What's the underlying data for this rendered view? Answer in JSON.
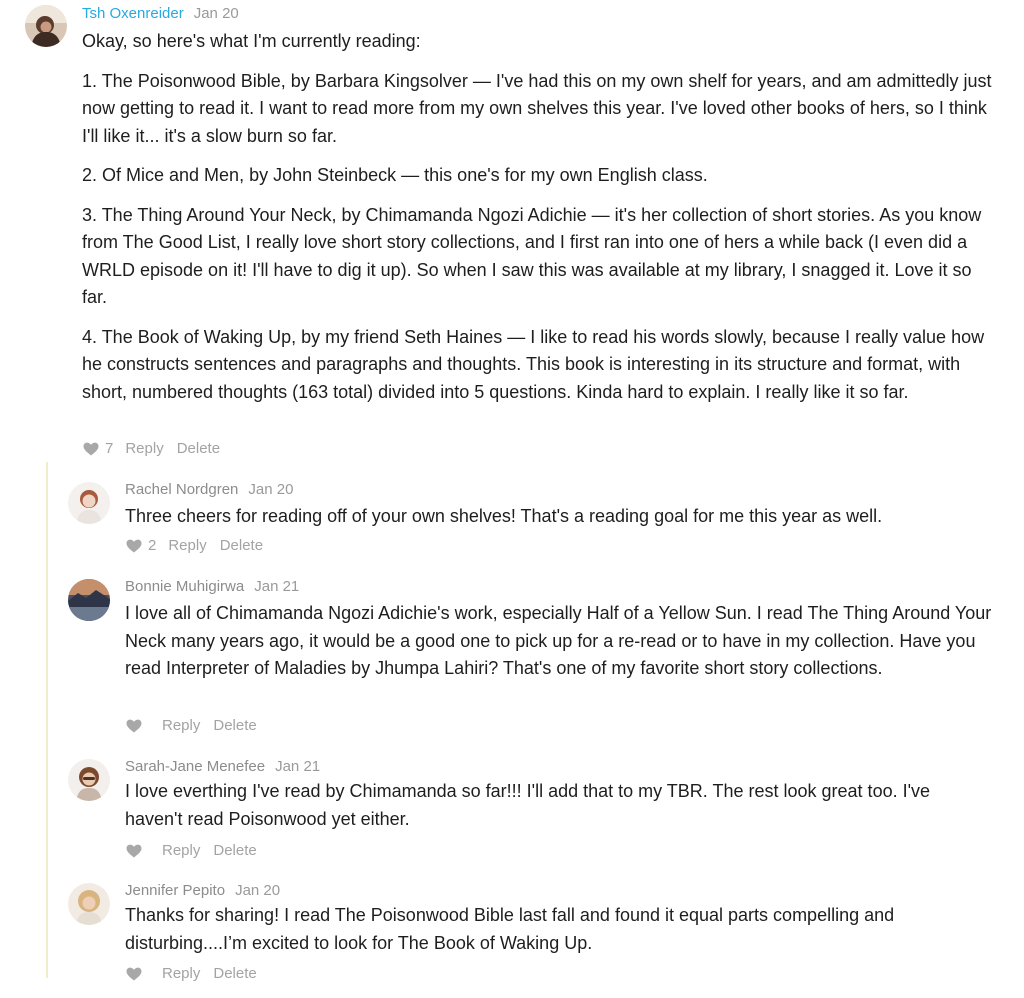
{
  "comments": [
    {
      "author": "Tsh Oxenreider",
      "date": "Jan 20",
      "paragraphs": [
        "Okay, so here's what I'm currently reading:",
        "1. The Poisonwood Bible, by Barbara Kingsolver — I've had this on my own shelf for years, and am admittedly just now getting to read it. I want to read more from my own shelves this year. I've loved other books of hers, so I think I'll like it... it's a slow burn so far.",
        "2. Of Mice and Men, by John Steinbeck — this one's for my own English class.",
        "3. The Thing Around Your Neck, by Chimamanda Ngozi Adichie — it's her collection of short stories. As you know from The Good List, I really love short story collections, and I first ran into one of hers a while back (I even did a WRLD episode on it! I'll have to dig it up). So when I saw this was available at my library, I snagged it. Love it so far.",
        "4. The Book of Waking Up, by my friend Seth Haines — I like to read his words slowly, because I really value how he constructs sentences and paragraphs and thoughts. This book is interesting in its structure and format, with short, numbered thoughts (163 total) divided into 5 questions. Kinda hard to explain. I really like it so far."
      ],
      "likes": "7",
      "reply_label": "Reply",
      "delete_label": "Delete"
    },
    {
      "author": "Rachel Nordgren",
      "date": "Jan 20",
      "paragraphs": [
        "Three cheers for reading off of your own shelves! That's a reading goal for me this year as well."
      ],
      "likes": "2",
      "reply_label": "Reply",
      "delete_label": "Delete"
    },
    {
      "author": "Bonnie Muhigirwa",
      "date": "Jan 21",
      "paragraphs": [
        "I love all of Chimamanda Ngozi Adichie's work, especially Half of a Yellow Sun. I read The Thing Around Your Neck many years ago, it would be a good one to pick up for a re-read or to have in my collection. Have you read Interpreter of Maladies by Jhumpa Lahiri? That's one of my favorite short story collections."
      ],
      "likes": "",
      "reply_label": "Reply",
      "delete_label": "Delete"
    },
    {
      "author": "Sarah-Jane Menefee",
      "date": "Jan 21",
      "paragraphs": [
        "I love everthing I've read by Chimamanda so far!!! I'll add that to my TBR. The rest look great too. I've haven't read Poisonwood yet either."
      ],
      "likes": "",
      "reply_label": "Reply",
      "delete_label": "Delete"
    },
    {
      "author": "Jennifer Pepito",
      "date": "Jan 20",
      "paragraphs": [
        "Thanks for sharing! I read The Poisonwood Bible last fall and found it equal parts compelling and disturbing....I’m excited to look for The Book of Waking Up."
      ],
      "likes": "",
      "reply_label": "Reply",
      "delete_label": "Delete"
    }
  ],
  "icons": {
    "like": "heart-icon"
  },
  "colors": {
    "author_link": "#27a9e1",
    "meta_gray": "#9a9a9a",
    "action_gray": "#a3a3a3",
    "thread_line": "#f1ecc9"
  }
}
